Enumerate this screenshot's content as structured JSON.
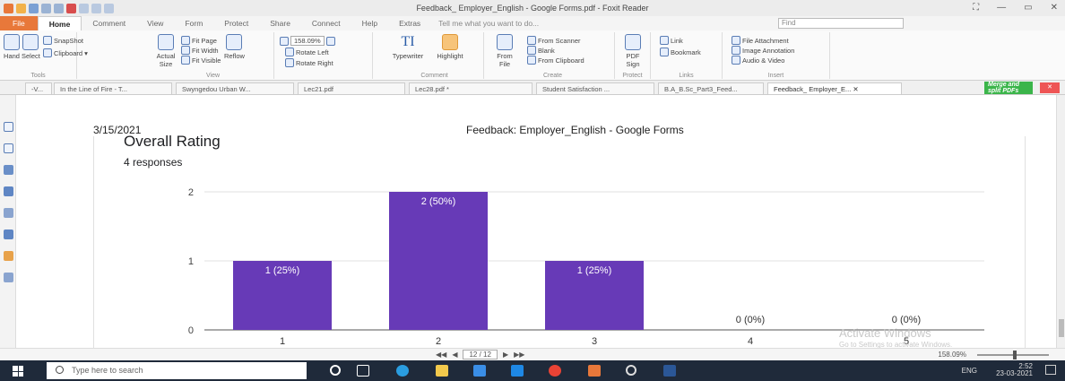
{
  "window": {
    "title": "Feedback_ Employer_English - Google Forms.pdf - Foxit Reader",
    "controls": [
      "⛶",
      "—",
      "▭",
      "✕"
    ]
  },
  "menu": {
    "tabs": [
      "File",
      "Home",
      "Comment",
      "View",
      "Form",
      "Protect",
      "Share",
      "Connect",
      "Help",
      "Extras"
    ],
    "active": "Home",
    "tell_me": "Tell me what you want to do...",
    "find_placeholder": "Find"
  },
  "ribbon": {
    "tools": {
      "hand": "Hand",
      "select": "Select",
      "snapshot": "SnapShot",
      "clipboard": "Clipboard ▾",
      "label": "Tools"
    },
    "view": {
      "actual_size": "Actual Size",
      "fit_page": "Fit Page",
      "fit_width": "Fit Width",
      "fit_visible": "Fit Visible",
      "reflow": "Reflow",
      "zoom": "158.09%",
      "rotate_left": "Rotate Left",
      "rotate_right": "Rotate Right",
      "label": "View"
    },
    "comment": {
      "typewriter": "Typewriter",
      "highlight": "Highlight",
      "label": "Comment"
    },
    "create": {
      "from_file": "From File",
      "from_scanner": "From Scanner",
      "blank": "Blank",
      "from_clipboard": "From Clipboard",
      "label": "Create"
    },
    "protect": {
      "pdf_sign": "PDF Sign",
      "label": "Protect"
    },
    "links": {
      "link": "Link",
      "bookmark": "Bookmark",
      "label": "Links"
    },
    "insert": {
      "file_attachment": "File Attachment",
      "image_annotation": "Image Annotation",
      "audio_video": "Audio & Video",
      "label": "Insert"
    }
  },
  "doc_tabs": [
    "-V...",
    "In the Line of Fire - T...",
    "Swyngedou Urban W...",
    "Lec21.pdf",
    "Lec28.pdf *",
    "Student Satisfaction ...",
    "B.A_B.Sc_Part3_Feed...",
    "Feedback_ Employer_E..."
  ],
  "merge_label": "Merge and split PDFs",
  "page": {
    "date": "3/15/2021",
    "header": "Feedback: Employer_English - Google Forms",
    "question_title": "Overall Rating",
    "responses": "4 responses"
  },
  "chart_data": {
    "type": "bar",
    "categories": [
      "1",
      "2",
      "3",
      "4",
      "5"
    ],
    "values": [
      1,
      2,
      1,
      0,
      0
    ],
    "data_labels": [
      "1 (25%)",
      "2 (50%)",
      "1 (25%)",
      "0 (0%)",
      "0 (0%)"
    ],
    "ylim": [
      0,
      2
    ],
    "yticks": [
      "0",
      "1",
      "2"
    ],
    "grid": true,
    "bar_color": "#673ab7"
  },
  "watermark": {
    "line1": "Activate Windows",
    "line2": "Go to Settings to activate Windows."
  },
  "status": {
    "page_indicator": "12 / 12",
    "zoom": "158.09%"
  },
  "taskbar": {
    "search_placeholder": "Type here to search",
    "language": "ENG",
    "time": "2:52",
    "date": "23-03-2021"
  }
}
